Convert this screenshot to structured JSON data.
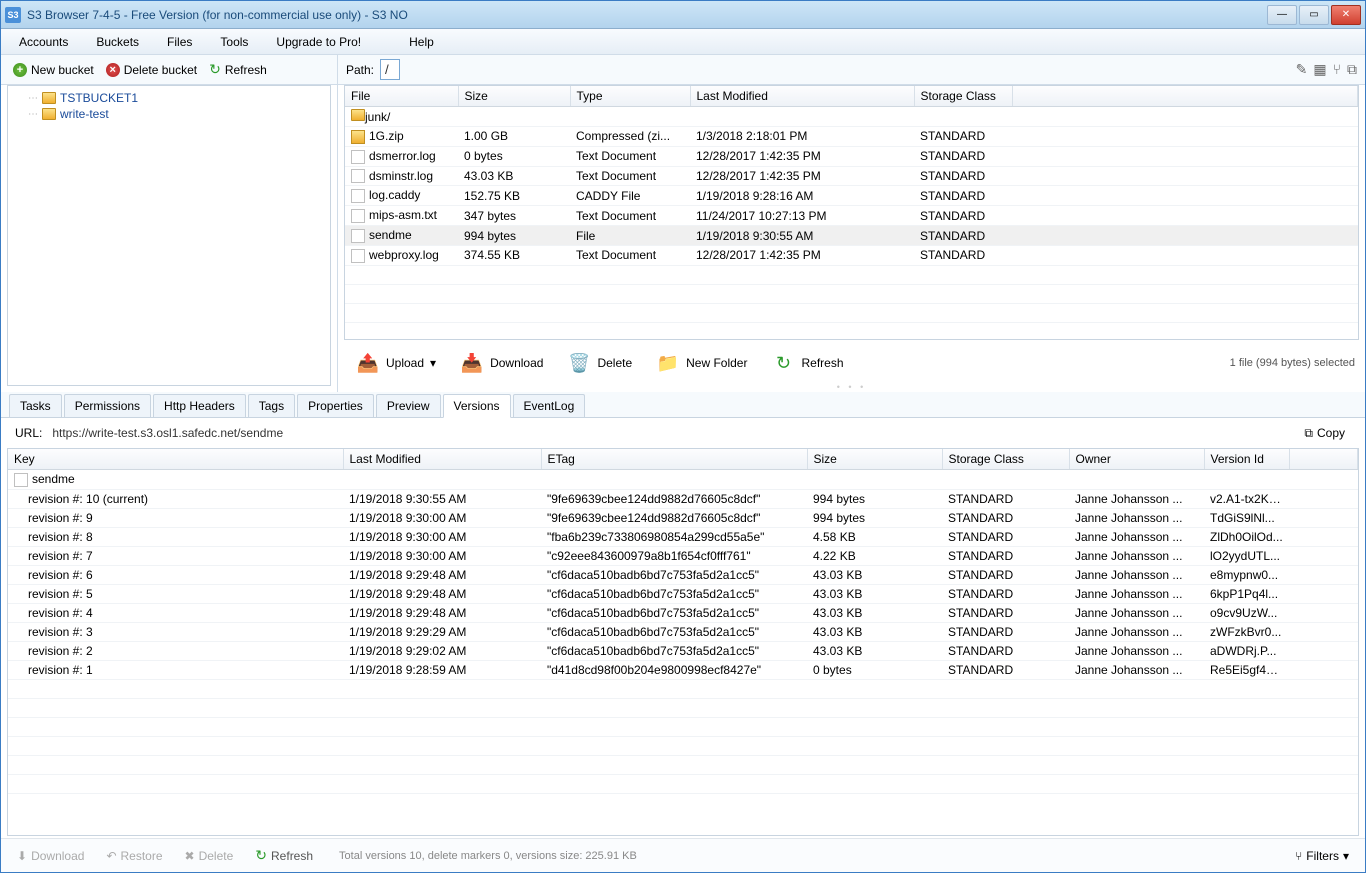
{
  "title": "S3 Browser 7-4-5 - Free Version (for non-commercial use only) - S3 NO",
  "menu": [
    "Accounts",
    "Buckets",
    "Files",
    "Tools",
    "Upgrade to Pro!",
    "Help"
  ],
  "bucketToolbar": {
    "newBucket": "New bucket",
    "deleteBucket": "Delete bucket",
    "refresh": "Refresh"
  },
  "buckets": [
    "TSTBUCKET1",
    "write-test"
  ],
  "pathLabel": "Path:",
  "pathValue": "/",
  "fileCols": [
    "File",
    "Size",
    "Type",
    "Last Modified",
    "Storage Class"
  ],
  "files": [
    {
      "name": "junk/",
      "size": "",
      "type": "",
      "modified": "",
      "class": "",
      "icon": "folder"
    },
    {
      "name": "1G.zip",
      "size": "1.00 GB",
      "type": "Compressed (zi...",
      "modified": "1/3/2018 2:18:01 PM",
      "class": "STANDARD",
      "icon": "zip"
    },
    {
      "name": "dsmerror.log",
      "size": "0 bytes",
      "type": "Text Document",
      "modified": "12/28/2017 1:42:35 PM",
      "class": "STANDARD",
      "icon": "file"
    },
    {
      "name": "dsminstr.log",
      "size": "43.03 KB",
      "type": "Text Document",
      "modified": "12/28/2017 1:42:35 PM",
      "class": "STANDARD",
      "icon": "file"
    },
    {
      "name": "log.caddy",
      "size": "152.75 KB",
      "type": "CADDY File",
      "modified": "1/19/2018 9:28:16 AM",
      "class": "STANDARD",
      "icon": "file"
    },
    {
      "name": "mips-asm.txt",
      "size": "347 bytes",
      "type": "Text Document",
      "modified": "11/24/2017 10:27:13 PM",
      "class": "STANDARD",
      "icon": "file"
    },
    {
      "name": "sendme",
      "size": "994 bytes",
      "type": "File",
      "modified": "1/19/2018 9:30:55 AM",
      "class": "STANDARD",
      "icon": "file",
      "selected": true
    },
    {
      "name": "webproxy.log",
      "size": "374.55 KB",
      "type": "Text Document",
      "modified": "12/28/2017 1:42:35 PM",
      "class": "STANDARD",
      "icon": "file"
    }
  ],
  "actions": {
    "upload": "Upload",
    "download": "Download",
    "delete": "Delete",
    "newFolder": "New Folder",
    "refresh": "Refresh"
  },
  "selectionStatus": "1 file (994 bytes) selected",
  "tabs": [
    "Tasks",
    "Permissions",
    "Http Headers",
    "Tags",
    "Properties",
    "Preview",
    "Versions",
    "EventLog"
  ],
  "activeTab": "Versions",
  "urlLabel": "URL:",
  "url": "https://write-test.s3.osl1.safedc.net/sendme",
  "copyLabel": "Copy",
  "versionCols": [
    "Key",
    "Last Modified",
    "ETag",
    "Size",
    "Storage Class",
    "Owner",
    "Version Id"
  ],
  "versionRoot": "sendme",
  "versions": [
    {
      "key": "revision #: 10 (current)",
      "modified": "1/19/2018 9:30:55 AM",
      "etag": "\"9fe69639cbee124dd9882d76605c8dcf\"",
      "size": "994 bytes",
      "class": "STANDARD",
      "owner": "Janne Johansson ...",
      "vid": "v2.A1-tx2KF..."
    },
    {
      "key": "revision #: 9",
      "modified": "1/19/2018 9:30:00 AM",
      "etag": "\"9fe69639cbee124dd9882d76605c8dcf\"",
      "size": "994 bytes",
      "class": "STANDARD",
      "owner": "Janne Johansson ...",
      "vid": "TdGiS9lNl..."
    },
    {
      "key": "revision #: 8",
      "modified": "1/19/2018 9:30:00 AM",
      "etag": "\"fba6b239c733806980854a299cd55a5e\"",
      "size": "4.58 KB",
      "class": "STANDARD",
      "owner": "Janne Johansson ...",
      "vid": "ZlDh0OilOd..."
    },
    {
      "key": "revision #: 7",
      "modified": "1/19/2018 9:30:00 AM",
      "etag": "\"c92eee843600979a8b1f654cf0fff761\"",
      "size": "4.22 KB",
      "class": "STANDARD",
      "owner": "Janne Johansson ...",
      "vid": "lO2yydUTL..."
    },
    {
      "key": "revision #: 6",
      "modified": "1/19/2018 9:29:48 AM",
      "etag": "\"cf6daca510badb6bd7c753fa5d2a1cc5\"",
      "size": "43.03 KB",
      "class": "STANDARD",
      "owner": "Janne Johansson ...",
      "vid": "e8mypnw0..."
    },
    {
      "key": "revision #: 5",
      "modified": "1/19/2018 9:29:48 AM",
      "etag": "\"cf6daca510badb6bd7c753fa5d2a1cc5\"",
      "size": "43.03 KB",
      "class": "STANDARD",
      "owner": "Janne Johansson ...",
      "vid": "6kpP1Pq4l..."
    },
    {
      "key": "revision #: 4",
      "modified": "1/19/2018 9:29:48 AM",
      "etag": "\"cf6daca510badb6bd7c753fa5d2a1cc5\"",
      "size": "43.03 KB",
      "class": "STANDARD",
      "owner": "Janne Johansson ...",
      "vid": "o9cv9UzW..."
    },
    {
      "key": "revision #: 3",
      "modified": "1/19/2018 9:29:29 AM",
      "etag": "\"cf6daca510badb6bd7c753fa5d2a1cc5\"",
      "size": "43.03 KB",
      "class": "STANDARD",
      "owner": "Janne Johansson ...",
      "vid": "zWFzkBvr0..."
    },
    {
      "key": "revision #: 2",
      "modified": "1/19/2018 9:29:02 AM",
      "etag": "\"cf6daca510badb6bd7c753fa5d2a1cc5\"",
      "size": "43.03 KB",
      "class": "STANDARD",
      "owner": "Janne Johansson ...",
      "vid": "aDWDRj.P..."
    },
    {
      "key": "revision #: 1",
      "modified": "1/19/2018 9:28:59 AM",
      "etag": "\"d41d8cd98f00b204e9800998ecf8427e\"",
      "size": "0 bytes",
      "class": "STANDARD",
      "owner": "Janne Johansson ...",
      "vid": "Re5Ei5gf4w..."
    }
  ],
  "bottomButtons": {
    "download": "Download",
    "restore": "Restore",
    "delete": "Delete",
    "refresh": "Refresh"
  },
  "versionsStatus": "Total versions 10, delete markers 0, versions size: 225.91 KB",
  "filtersLabel": "Filters"
}
